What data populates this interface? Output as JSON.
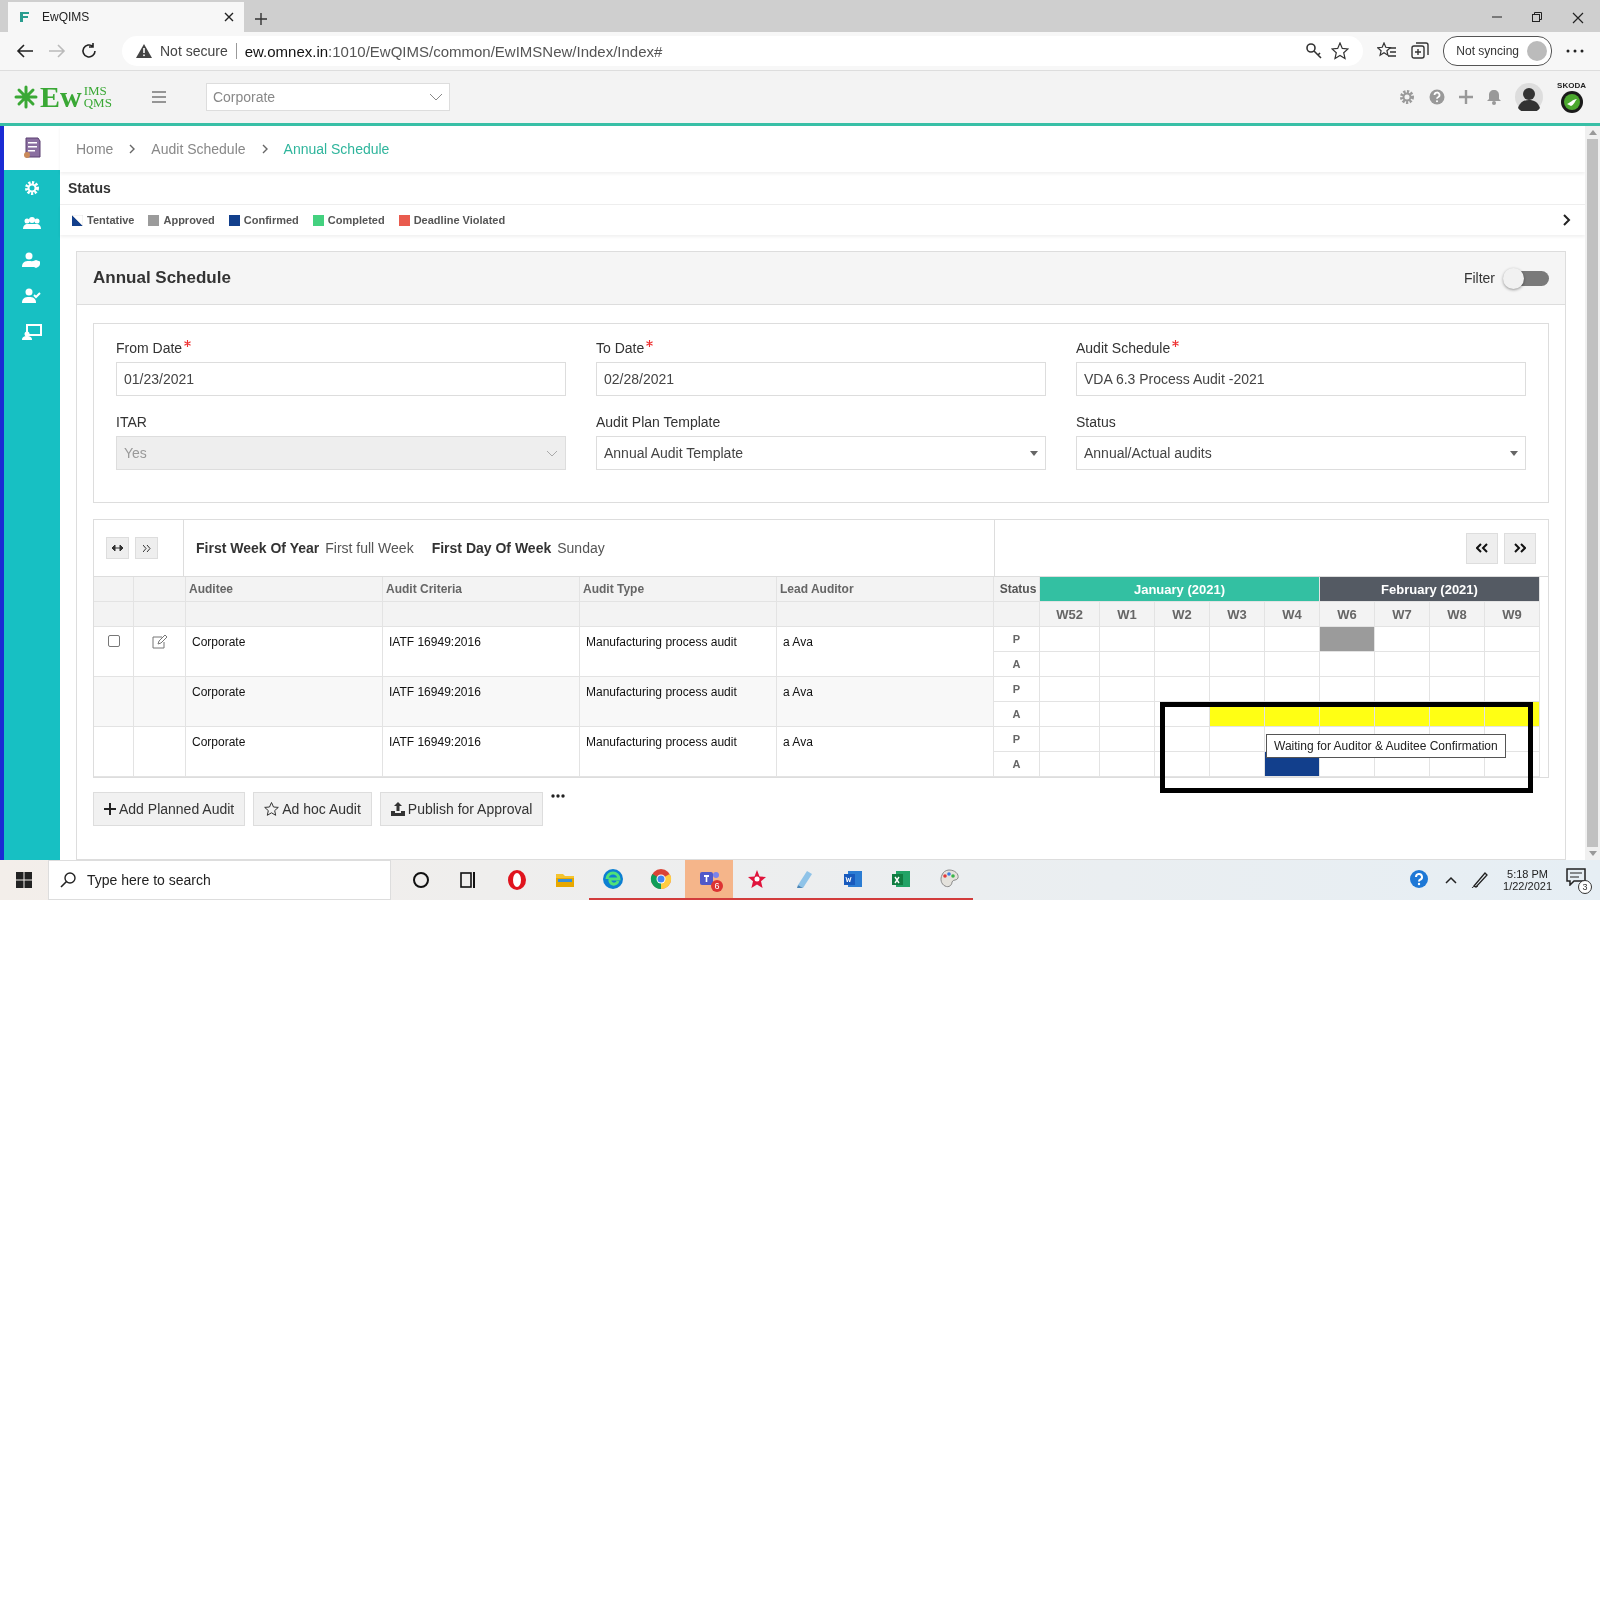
{
  "browser": {
    "tab_title": "EwQIMS",
    "security": "Not secure",
    "url_host": "ew.omnex.in",
    "url_path": ":1010/EwQIMS/common/EwIMSNew/Index/Index#",
    "sync": "Not syncing"
  },
  "header": {
    "logo_main": "Ew",
    "logo_top": "IMS",
    "logo_bottom": "QMS",
    "site": "Corporate",
    "brand": "SKODA"
  },
  "sidebar": {
    "items": [
      {
        "kind": "document",
        "selected": true
      },
      {
        "kind": "gear",
        "selected": false
      },
      {
        "kind": "group",
        "selected": false
      },
      {
        "kind": "user-shield",
        "selected": false
      },
      {
        "kind": "user-check",
        "selected": false
      },
      {
        "kind": "screen-user",
        "selected": false
      }
    ]
  },
  "breadcrumb": [
    {
      "label": "Home",
      "current": false
    },
    {
      "label": "Audit Schedule",
      "current": false
    },
    {
      "label": "Annual Schedule",
      "current": true
    }
  ],
  "status_legend": {
    "title": "Status",
    "items": [
      {
        "label": "Tentative",
        "color": "#123f8c",
        "kind": "split"
      },
      {
        "label": "Approved",
        "color": "#9b9b9b",
        "kind": "solid"
      },
      {
        "label": "Confirmed",
        "color": "#123f8c",
        "kind": "solid"
      },
      {
        "label": "Completed",
        "color": "#44d17f",
        "kind": "solid"
      },
      {
        "label": "Deadline Violated",
        "color": "#e95b4e",
        "kind": "solid"
      }
    ]
  },
  "schedule": {
    "title": "Annual Schedule",
    "filter": {
      "label": "Filter",
      "on": false
    },
    "fields": [
      {
        "label": "From Date",
        "required": true,
        "value": "01/23/2021",
        "kind": "text",
        "disabled": false
      },
      {
        "label": "To Date",
        "required": true,
        "value": "02/28/2021",
        "kind": "text",
        "disabled": false
      },
      {
        "label": "Audit Schedule",
        "required": true,
        "value": "VDA 6.3 Process Audit -2021",
        "kind": "text",
        "disabled": false
      },
      {
        "label": "ITAR",
        "required": false,
        "value": "Yes",
        "kind": "select",
        "disabled": true
      },
      {
        "label": "Audit Plan Template",
        "required": false,
        "value": "Annual Audit Template",
        "kind": "dropdown",
        "disabled": false
      },
      {
        "label": "Status",
        "required": false,
        "value": "Annual/Actual audits",
        "kind": "dropdown",
        "disabled": false
      }
    ],
    "week_info": [
      {
        "label": "First Week Of Year",
        "value": "First full Week"
      },
      {
        "label": "First Day Of Week",
        "value": "Sunday"
      }
    ],
    "columns": [
      "Auditee",
      "Audit Criteria",
      "Audit Type",
      "Lead Auditor"
    ],
    "status_column": "Status",
    "months": [
      {
        "label": "January (2021)",
        "color": "#33c0a2",
        "weeks": [
          "W52",
          "W1",
          "W2",
          "W3",
          "W4"
        ]
      },
      {
        "label": "February (2021)",
        "color": "#545a63",
        "weeks": [
          "W6",
          "W7",
          "W8",
          "W9"
        ]
      }
    ],
    "rows": [
      {
        "kind": "editable",
        "checked": false,
        "auditee": "Corporate",
        "criteria": "IATF 16949:2016",
        "type": "Manufacturing process audit",
        "lead": "a Ava",
        "lines": [
          {
            "label": "P",
            "cells": [
              {
                "kind": "empty"
              },
              {
                "kind": "empty"
              },
              {
                "kind": "empty"
              },
              {
                "kind": "empty"
              },
              {
                "kind": "empty"
              },
              {
                "kind": "approved"
              },
              {
                "kind": "empty"
              },
              {
                "kind": "empty"
              },
              {
                "kind": "empty"
              }
            ]
          },
          {
            "label": "A",
            "cells": [
              {
                "kind": "empty"
              },
              {
                "kind": "empty"
              },
              {
                "kind": "empty"
              },
              {
                "kind": "empty"
              },
              {
                "kind": "empty"
              },
              {
                "kind": "empty"
              },
              {
                "kind": "empty"
              },
              {
                "kind": "empty"
              },
              {
                "kind": "empty"
              }
            ]
          }
        ]
      },
      {
        "kind": "plain",
        "auditee": "Corporate",
        "criteria": "IATF 16949:2016",
        "type": "Manufacturing process audit",
        "lead": "a Ava",
        "lines": [
          {
            "label": "P",
            "cells": [
              {
                "kind": "empty"
              },
              {
                "kind": "empty"
              },
              {
                "kind": "empty"
              },
              {
                "kind": "empty"
              },
              {
                "kind": "empty"
              },
              {
                "kind": "empty"
              },
              {
                "kind": "empty"
              },
              {
                "kind": "empty"
              },
              {
                "kind": "empty"
              }
            ]
          },
          {
            "label": "A",
            "cells": [
              {
                "kind": "empty"
              },
              {
                "kind": "empty"
              },
              {
                "kind": "empty"
              },
              {
                "kind": "highlight"
              },
              {
                "kind": "highlight"
              },
              {
                "kind": "highlight"
              },
              {
                "kind": "highlight"
              },
              {
                "kind": "highlight"
              },
              {
                "kind": "highlight"
              }
            ]
          }
        ]
      },
      {
        "kind": "plain",
        "auditee": "Corporate",
        "criteria": "IATF 16949:2016",
        "type": "Manufacturing process audit",
        "lead": "a Ava",
        "lines": [
          {
            "label": "P",
            "cells": [
              {
                "kind": "empty"
              },
              {
                "kind": "empty"
              },
              {
                "kind": "empty"
              },
              {
                "kind": "empty"
              },
              {
                "kind": "empty"
              },
              {
                "kind": "empty"
              },
              {
                "kind": "empty"
              },
              {
                "kind": "empty"
              },
              {
                "kind": "empty"
              }
            ]
          },
          {
            "label": "A",
            "cells": [
              {
                "kind": "empty"
              },
              {
                "kind": "empty"
              },
              {
                "kind": "empty"
              },
              {
                "kind": "empty"
              },
              {
                "kind": "confirmed"
              },
              {
                "kind": "empty"
              },
              {
                "kind": "empty"
              },
              {
                "kind": "empty"
              },
              {
                "kind": "empty"
              }
            ]
          }
        ]
      }
    ],
    "tooltip": "Waiting for Auditor & Auditee Confirmation",
    "buttons": [
      {
        "label": "Add Planned Audit"
      },
      {
        "label": "Ad hoc Audit"
      },
      {
        "label": "Publish for Approval"
      }
    ]
  },
  "taskbar": {
    "search_placeholder": "Type here to search",
    "apps": [
      {
        "kind": "cortana",
        "running": false,
        "selected": false
      },
      {
        "kind": "taskview",
        "running": false,
        "selected": false
      },
      {
        "kind": "opera",
        "running": false,
        "selected": false
      },
      {
        "kind": "folder",
        "running": false,
        "selected": false
      },
      {
        "kind": "edge",
        "running": true,
        "selected": false
      },
      {
        "kind": "chrome",
        "running": true,
        "selected": false
      },
      {
        "kind": "teams",
        "running": true,
        "selected": true,
        "badge": "6"
      },
      {
        "kind": "star",
        "running": true,
        "selected": false
      },
      {
        "kind": "notepad",
        "running": true,
        "selected": false
      },
      {
        "kind": "word",
        "running": true,
        "selected": false
      },
      {
        "kind": "excel",
        "running": true,
        "selected": false
      },
      {
        "kind": "paint",
        "running": true,
        "selected": false
      }
    ],
    "time": "5:18 PM",
    "date": "1/22/2021",
    "notifications": "3"
  }
}
